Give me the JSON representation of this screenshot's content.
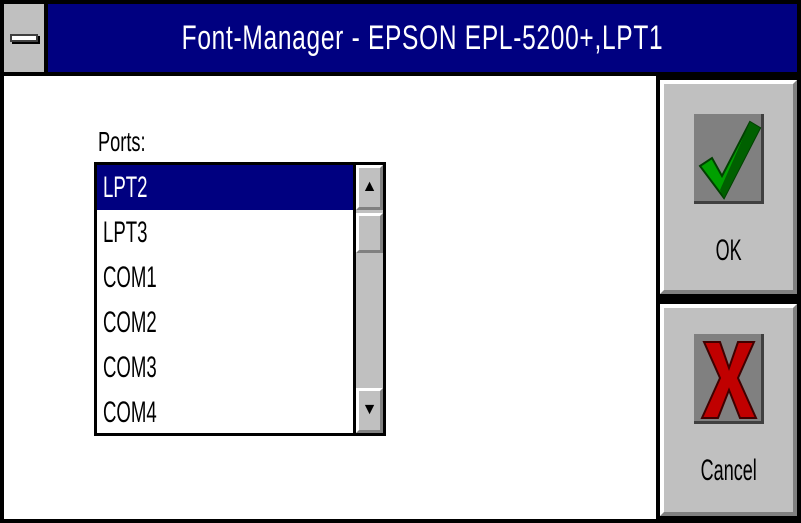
{
  "window": {
    "title": "Font-Manager  - EPSON  EPL-5200+,LPT1"
  },
  "ports": {
    "label": "Ports:",
    "items": [
      "LPT2",
      "LPT3",
      "COM1",
      "COM2",
      "COM3",
      "COM4"
    ],
    "selected": "LPT2"
  },
  "buttons": {
    "ok_label": "OK",
    "cancel_label": "Cancel"
  },
  "icons": {
    "system_menu": "system-menu-icon",
    "ok": "checkmark-icon",
    "cancel": "x-icon",
    "scroll_up": "arrow-up-icon",
    "scroll_down": "arrow-down-icon"
  },
  "colors": {
    "title_bar": "#000080",
    "selection": "#000080",
    "check": "#00a000",
    "cross": "#c00000",
    "button_face": "#c0c0c0"
  }
}
